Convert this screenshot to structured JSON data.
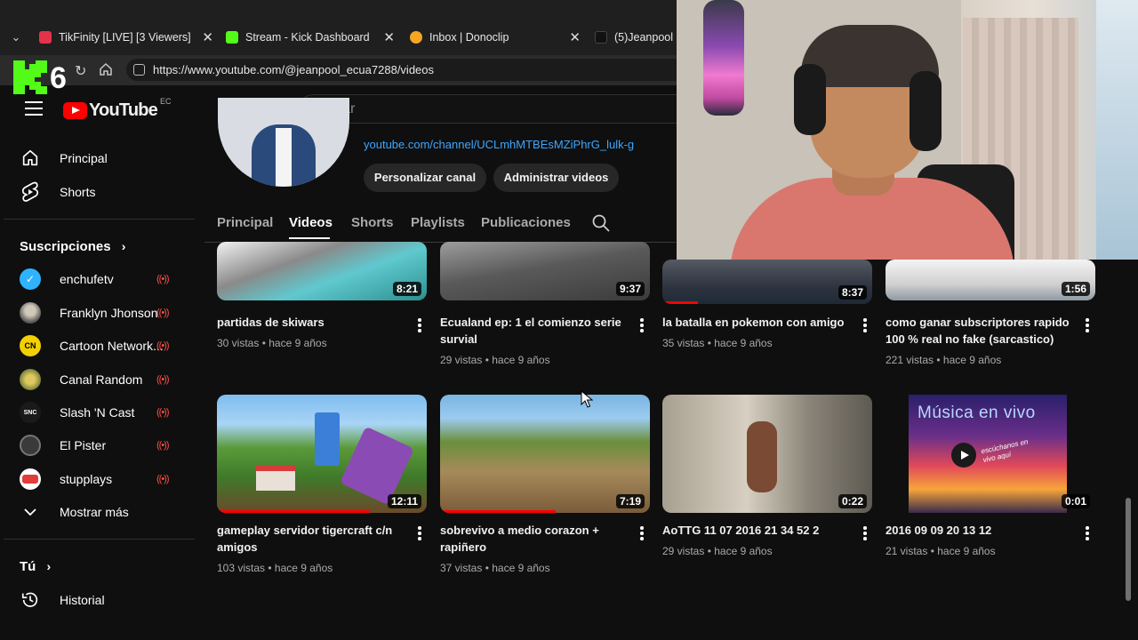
{
  "browser": {
    "tabs": [
      {
        "label": "TikFinity [LIVE] [3 Viewers]",
        "favicon_color": "#e2334a"
      },
      {
        "label": "Stream - Kick Dashboard",
        "favicon_color": "#53fc18"
      },
      {
        "label": "Inbox | Donoclip",
        "favicon_color": "#f5a623"
      },
      {
        "label": "(5)Jeanpool (@",
        "favicon_color": "#111111"
      }
    ],
    "url": "https://www.youtube.com/@jeanpool_ecua7288/videos"
  },
  "overlay": {
    "kick_number": "6"
  },
  "youtube": {
    "logo_text": "YouTube",
    "country_code": "EC",
    "search_placeholder": "Buscar"
  },
  "sidebar": {
    "main": [
      {
        "label": "Principal",
        "icon": "home-icon"
      },
      {
        "label": "Shorts",
        "icon": "shorts-icon"
      }
    ],
    "subscriptions_heading": "Suscripciones",
    "subscriptions": [
      {
        "label": "enchufetv",
        "live": true,
        "avatar_color": "#2fb3ff"
      },
      {
        "label": "Franklyn Jhonson",
        "live": true,
        "avatar_color": "#8a8f98"
      },
      {
        "label": "Cartoon Network...",
        "live": true,
        "avatar_color": "#f4d000"
      },
      {
        "label": "Canal Random",
        "live": true,
        "avatar_color": "#c2a63c"
      },
      {
        "label": "Slash 'N Cast",
        "live": true,
        "avatar_color": "#1a1a1a"
      },
      {
        "label": "El Pister",
        "live": true,
        "avatar_color": "#3a3a3a"
      },
      {
        "label": "stupplays",
        "live": true,
        "avatar_color": "#e23c3c"
      }
    ],
    "show_more": "Mostrar más",
    "you_heading": "Tú",
    "history": "Historial"
  },
  "channel": {
    "link": "youtube.com/channel/UCLmhMTBEsMZiPhrG_lulk-g",
    "customize_button": "Personalizar canal",
    "manage_button": "Administrar videos",
    "tabs": [
      "Principal",
      "Videos",
      "Shorts",
      "Playlists",
      "Publicaciones"
    ],
    "active_tab": "Videos"
  },
  "videos": [
    {
      "title": "partidas de skiwars",
      "meta": "30 vistas • hace 9 años",
      "duration": "8:21",
      "progress": 0,
      "colors": [
        "#6bd3d8",
        "#8a8a8a"
      ]
    },
    {
      "title": "Ecualand ep: 1 el comienzo serie survial",
      "meta": "29 vistas • hace 9 años",
      "duration": "9:37",
      "progress": 0,
      "colors": [
        "#444444",
        "#5c5c5c"
      ]
    },
    {
      "title": "la batalla en pokemon con amigo",
      "meta": "35 vistas • hace 9 años",
      "duration": "8:37",
      "progress": 0.17,
      "colors": [
        "#2e3440",
        "#4b5360"
      ]
    },
    {
      "title": "como ganar subscriptores rapido 100 % real no fake (sarcastico)",
      "meta": "221 vistas • hace 9 años",
      "duration": "1:56",
      "progress": 0,
      "colors": [
        "#d8d8d8",
        "#9aa7b0"
      ]
    },
    {
      "title": "gameplay servidor tigercraft c/n amigos",
      "meta": "103 vistas • hace 9 años",
      "duration": "12:11",
      "progress": 0.73,
      "colors": [
        "#6fb0e6",
        "#4f8a2f"
      ]
    },
    {
      "title": "sobrevivo a medio corazon + rapiñero",
      "meta": "37 vistas • hace 9 años",
      "duration": "7:19",
      "progress": 0.55,
      "colors": [
        "#78b3e0",
        "#6a8a3a"
      ]
    },
    {
      "title": "AoTTG 11 07 2016 21 34 52 2",
      "meta": "29 vistas • hace 9 años",
      "duration": "0:22",
      "progress": 0,
      "colors": [
        "#b9b2a5",
        "#6e6a60"
      ]
    },
    {
      "title": "2016 09 09 20 13 12",
      "meta": "21 vistas • hace 9 años",
      "duration": "0:01",
      "progress": 0,
      "colors": [
        "#3b2a7a",
        "#f2a040"
      ],
      "overlay_title": "Música en vivo",
      "overlay_sub": "escúchanos en vivo aquí"
    }
  ]
}
